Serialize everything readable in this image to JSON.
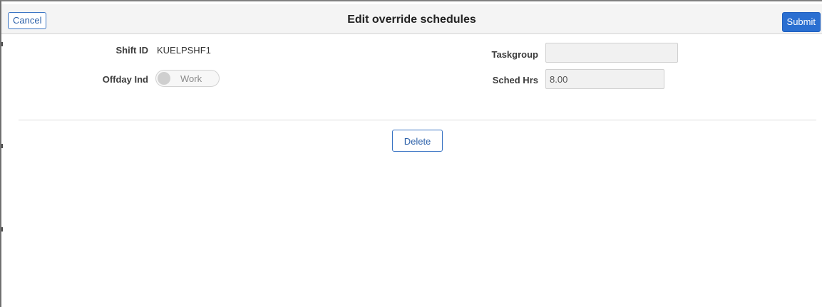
{
  "header": {
    "cancel_label": "Cancel",
    "title": "Edit override schedules",
    "submit_label": "Submit"
  },
  "form": {
    "shift_id": {
      "label": "Shift ID",
      "value": "KUELPSHF1"
    },
    "offday_ind": {
      "label": "Offday Ind",
      "toggle_text": "Work",
      "checked": false
    },
    "taskgroup": {
      "label": "Taskgroup",
      "value": ""
    },
    "sched_hrs": {
      "label": "Sched Hrs",
      "value": "8.00"
    }
  },
  "actions": {
    "delete_label": "Delete"
  },
  "colors": {
    "accent": "#2a6fd1",
    "header_bg": "#f4f4f4",
    "field_bg": "#f1f1f1"
  }
}
